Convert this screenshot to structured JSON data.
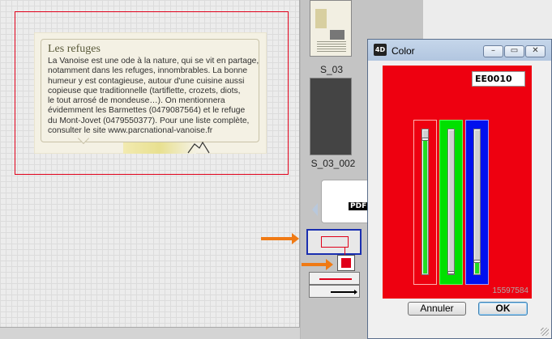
{
  "article": {
    "title": "Les refuges",
    "body": "La Vanoise est une ode à la nature, qui se vit en partage,\nnotamment dans les refuges, innombrables. La bonne\nhumeur y est contagieuse, autour d'une cuisine aussi\ncopieuse que traditionnelle (tartiflette, crozets, diots,\nle tout arrosé de mondeuse…). On mentionnera\névidemment les Barmettes (0479087564) et le refuge\ndu Mont-Jovet (0479550377). Pour une liste complète,\nconsulter le site www.parcnational-vanoise.fr"
  },
  "thumbnails": [
    {
      "label": "S_03"
    },
    {
      "label": "S_03_002"
    },
    {
      "badge": "PDF"
    }
  ],
  "dialog": {
    "title": "Color",
    "logo": "4D",
    "hex_value": "EE0010",
    "numeric_value": "15597584",
    "cancel_label": "Annuler",
    "ok_label": "OK",
    "window_buttons": {
      "minimize": "–",
      "maximize": "▭",
      "close": "✕"
    },
    "channels": [
      {
        "name": "red",
        "level": 0.93
      },
      {
        "name": "green",
        "level": 0.0
      },
      {
        "name": "blue",
        "level": 0.08
      }
    ]
  },
  "colors": {
    "selected": "#ee0010",
    "frame": "#e0001a",
    "callout_arrow": "#f07a14",
    "selection_border": "#1a2fb0"
  },
  "icons": {
    "dialog_logo": "4d-logo-icon",
    "nav_left": "triangle-left-icon",
    "callout_arrow": "orange-arrow-icon"
  }
}
